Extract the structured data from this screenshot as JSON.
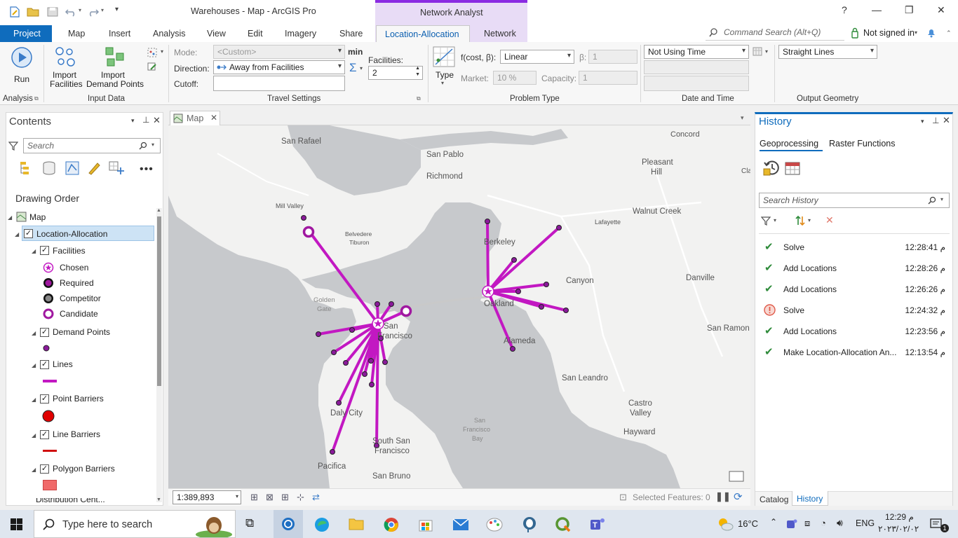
{
  "window": {
    "title": "Warehouses - Map - ArcGIS Pro",
    "context_tab_group": "Network Analyst",
    "help": "?",
    "minimize": "—",
    "restore": "❐",
    "close": "✕"
  },
  "tabs": {
    "project": "Project",
    "items": [
      "Map",
      "Insert",
      "Analysis",
      "View",
      "Edit",
      "Imagery",
      "Share"
    ],
    "contextual": [
      "Location-Allocation",
      "Network"
    ],
    "command_search_placeholder": "Command Search (Alt+Q)",
    "sign_in": "Not signed in"
  },
  "ribbon": {
    "analysis": {
      "run": "Run",
      "group": "Analysis"
    },
    "input_data": {
      "import_facilities": [
        "Import",
        "Facilities"
      ],
      "import_demand": [
        "Import",
        "Demand Points"
      ],
      "group": "Input Data"
    },
    "travel": {
      "mode_label": "Mode:",
      "mode_value": "<Custom>",
      "min": "min",
      "direction_label": "Direction:",
      "direction_value": "Away from Facilities",
      "cutoff_label": "Cutoff:",
      "cutoff_value": "",
      "facilities_label": "Facilities:",
      "facilities_value": "2",
      "group": "Travel Settings"
    },
    "problem": {
      "type": "Type",
      "fcost_label": "f(cost, β):",
      "fcost_value": "Linear",
      "beta_label": "β:",
      "beta_value": "1",
      "market_label": "Market:",
      "market_value": "10  %",
      "capacity_label": "Capacity:",
      "capacity_value": "1",
      "group": "Problem Type"
    },
    "datetime": {
      "time_value": "Not Using Time",
      "group": "Date and Time"
    },
    "output": {
      "value": "Straight Lines",
      "group": "Output Geometry"
    }
  },
  "contents": {
    "title": "Contents",
    "search_placeholder": "Search",
    "drawing_order": "Drawing Order",
    "tree": {
      "map": "Map",
      "layer": "Location-Allocation",
      "facilities": "Facilities",
      "chosen": "Chosen",
      "required": "Required",
      "competitor": "Competitor",
      "candidate": "Candidate",
      "demand": "Demand Points",
      "lines": "Lines",
      "point_barriers": "Point Barriers",
      "line_barriers": "Line Barriers",
      "polygon_barriers": "Polygon Barriers",
      "distribution": "Distribution Cent..."
    }
  },
  "map": {
    "tab": "Map",
    "scale": "1:389,893",
    "selected_features": "Selected Features: 0",
    "labels": {
      "san_rafael": "San Rafael",
      "san_pablo": "San Pablo",
      "richmond": "Richmond",
      "concord": "Concord",
      "pleasant": "Pleasant",
      "hill": "Hill",
      "cla": "Cla",
      "mill_valley": "Mill Valley",
      "belvedere": "Belvedere",
      "tiburon": "Tiburon",
      "walnut_creek": "Walnut Creek",
      "lafayette": "Lafayette",
      "berkeley": "Berkeley",
      "canyon": "Canyon",
      "danville": "Danville",
      "golden": "Golden",
      "gate": "Gate",
      "san": "San",
      "francisco": "Francisco",
      "oakland": "Oakland",
      "alameda": "Alameda",
      "san_ramon": "San Ramon",
      "san_leandro": "San Leandro",
      "daly_city": "Daly City",
      "castro": "Castro",
      "valley": "Valley",
      "hayward": "Hayward",
      "bay_1": "San",
      "bay_2": "Francisco",
      "bay_3": "Bay",
      "south_sf_1": "South San",
      "south_sf_2": "Francisco",
      "pacifica": "Pacifica",
      "san_bruno": "San Bruno"
    }
  },
  "history": {
    "title": "History",
    "tabs": [
      "Geoprocessing",
      "Raster Functions"
    ],
    "search_placeholder": "Search History",
    "items": [
      {
        "name": "Solve",
        "time": "12:28:41 م",
        "status": "success"
      },
      {
        "name": "Add Locations",
        "time": "12:28:26 م",
        "status": "success"
      },
      {
        "name": "Add Locations",
        "time": "12:26:26 م",
        "status": "success"
      },
      {
        "name": "Solve",
        "time": "12:24:32 م",
        "status": "warning"
      },
      {
        "name": "Add Locations",
        "time": "12:23:56 م",
        "status": "success"
      },
      {
        "name": "Make Location-Allocation An...",
        "time": "12:13:54 م",
        "status": "success"
      }
    ],
    "bottom_tabs": [
      "Catalog",
      "History"
    ]
  },
  "taskbar": {
    "search_placeholder": "Type here to search",
    "temperature": "16°C",
    "lang": "ENG",
    "time": "12:29 م",
    "date": "٢٠٢٣/٠٢/٠٢"
  },
  "colors": {
    "accent": "#0f6cbd",
    "context_purple": "#8b2be2",
    "route": "#c218c2",
    "demand": "#7a1a8a",
    "success": "#2e8b3a",
    "warning": "#e05a4a"
  }
}
